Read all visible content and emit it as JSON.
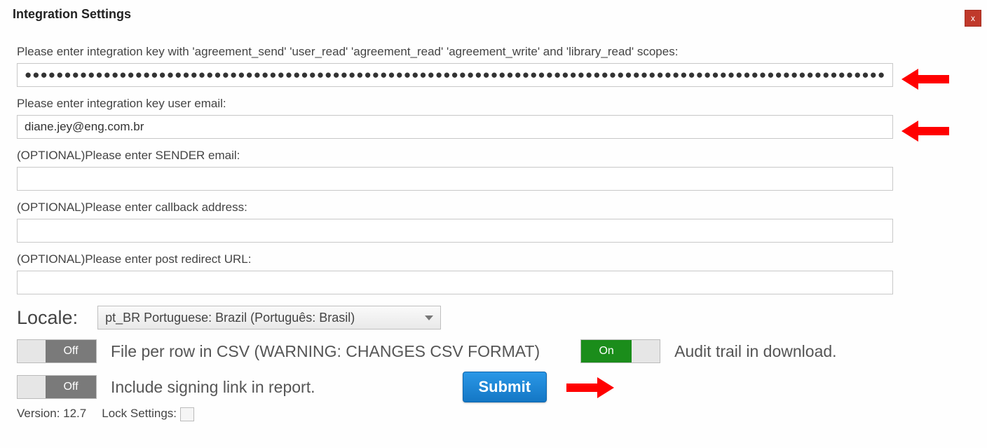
{
  "window": {
    "title": "Integration Settings",
    "close": "x"
  },
  "fields": {
    "key_label": "Please enter integration key with 'agreement_send' 'user_read' 'agreement_read' 'agreement_write' and 'library_read' scopes:",
    "key_value": "●●●●●●●●●●●●●●●●●●●●●●●●●●●●●●●●●●●●●●●●●●●●●●●●●●●●●●●●●●●●●●●●●●●●●●●●●●●●●●●●●●●●●●●●●●●●●●●●●●●●●●●●●●●●●●●●●●●●●●●●●●●●●●●●",
    "email_label": "Please enter integration key user email:",
    "email_value": "diane.jey@eng.com.br",
    "sender_label": "(OPTIONAL)Please enter SENDER email:",
    "sender_value": "",
    "callback_label": "(OPTIONAL)Please enter callback address:",
    "callback_value": "",
    "redirect_label": "(OPTIONAL)Please enter post redirect URL:",
    "redirect_value": ""
  },
  "locale": {
    "label": "Locale:",
    "selected": "pt_BR Portuguese: Brazil (Português: Brasil)"
  },
  "toggles": {
    "off_label": "Off",
    "on_label": "On",
    "file_per_row": {
      "state": "off",
      "text": "File per row in CSV (WARNING: CHANGES CSV FORMAT)"
    },
    "audit_trail": {
      "state": "on",
      "text": "Audit trail in download."
    },
    "signing_link": {
      "state": "off",
      "text": "Include signing link in report."
    }
  },
  "submit": {
    "label": "Submit"
  },
  "footer": {
    "version": "Version: 12.7",
    "lock_label": "Lock Settings:"
  }
}
